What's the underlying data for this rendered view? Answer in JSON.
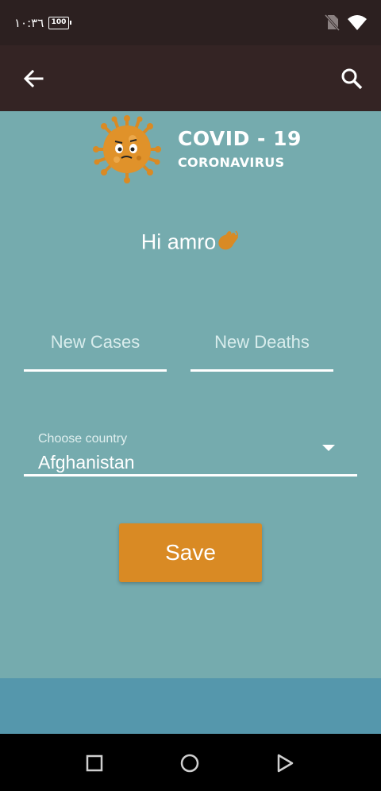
{
  "status_bar": {
    "time": "١٠:٣٦",
    "battery": "100"
  },
  "app_bar": {
    "back_icon": "arrow-left-icon",
    "search_icon": "search-icon"
  },
  "banner": {
    "title": "COVID - 19",
    "subtitle": "CORONAVIRUS"
  },
  "greeting": {
    "text": "Hi amro"
  },
  "form": {
    "new_cases_placeholder": "New Cases",
    "new_deaths_placeholder": "New Deaths",
    "country_label": "Choose country",
    "country_value": "Afghanistan",
    "save_label": "Save"
  },
  "colors": {
    "background": "#75abae",
    "app_bar": "#342424",
    "status_bar": "#2c2020",
    "accent": "#d98a24",
    "bottom_strip": "#5597ac"
  }
}
